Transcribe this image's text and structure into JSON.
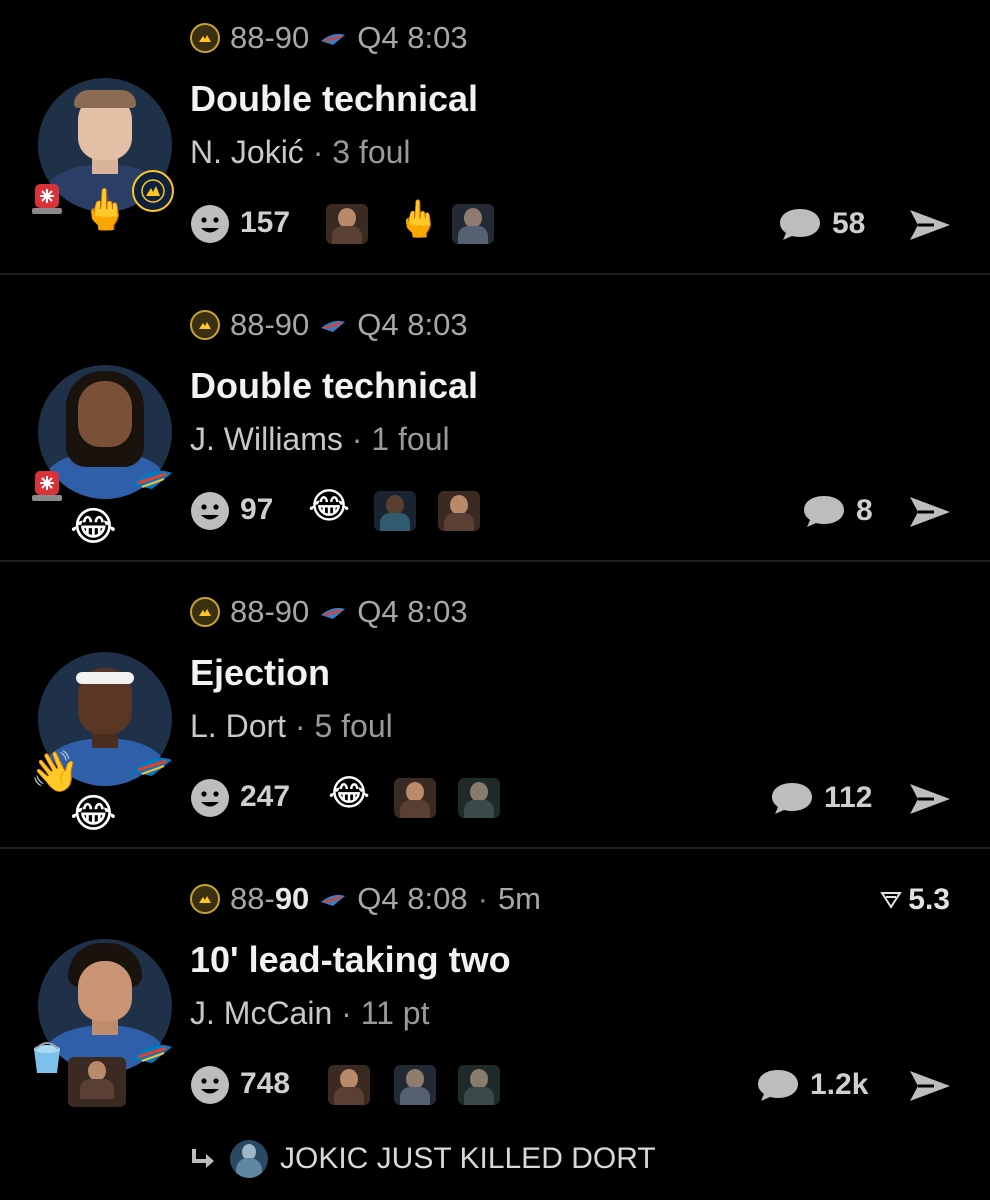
{
  "colors": {
    "background": "#000000",
    "text_primary": "#f2f2f2",
    "text_secondary": "#a7a7a7",
    "divider": "#1f1f1f",
    "nuggets_gold": "#fec524",
    "nuggets_navy": "#0e2240",
    "okc_blue": "#007ac1",
    "okc_orange": "#ef3b24"
  },
  "posts": [
    {
      "score": "88-90",
      "clock": "Q4 8:03",
      "time_ago": "",
      "odds": "",
      "title": "Double technical",
      "player": "N. Jokić",
      "stat": "3 foul",
      "team": "nuggets",
      "badge_icons": [
        "siren-icon",
        "middle-finger-icon"
      ],
      "badge_emoji": "🖕",
      "reaction_count": "157",
      "reactions": [
        "gif-thumb",
        "middle-finger-emoji",
        "gif-thumb"
      ],
      "reaction_emoji": "🖕",
      "comment_count": "58"
    },
    {
      "score": "88-90",
      "clock": "Q4 8:03",
      "time_ago": "",
      "odds": "",
      "title": "Double technical",
      "player": "J. Williams",
      "stat": "1 foul",
      "team": "thunder",
      "badge_icons": [
        "siren-icon",
        "laughing-icon"
      ],
      "badge_emoji": "😂",
      "reaction_count": "97",
      "reactions": [
        "laughing-emoji",
        "gif-thumb",
        "gif-thumb"
      ],
      "reaction_emoji": "😂",
      "comment_count": "8"
    },
    {
      "score": "88-90",
      "clock": "Q4 8:03",
      "time_ago": "",
      "odds": "",
      "title": "Ejection",
      "player": "L. Dort",
      "stat": "5 foul",
      "team": "thunder",
      "badge_icons": [
        "waving-hand-icon",
        "laughing-icon"
      ],
      "badge_emoji": "😂",
      "badge_emoji_2": "👋",
      "reaction_count": "247",
      "reactions": [
        "laughing-emoji",
        "gif-thumb",
        "gif-thumb"
      ],
      "reaction_emoji": "😂",
      "comment_count": "112"
    },
    {
      "score_home": "88",
      "score_sep": "-",
      "score_away": "90",
      "clock": "Q4 8:08",
      "time_ago": "5m",
      "odds": "5.3",
      "title": "10' lead-taking two",
      "player": "J. McCain",
      "stat": "11 pt",
      "team": "thunder",
      "badge_icons": [
        "bucket-icon",
        "gif-thumb"
      ],
      "reaction_count": "748",
      "reactions": [
        "gif-thumb",
        "gif-thumb",
        "gif-thumb"
      ],
      "comment_count": "1.2k"
    }
  ],
  "reply": {
    "text": "JOKIC JUST KILLED DORT"
  },
  "separator": "·"
}
